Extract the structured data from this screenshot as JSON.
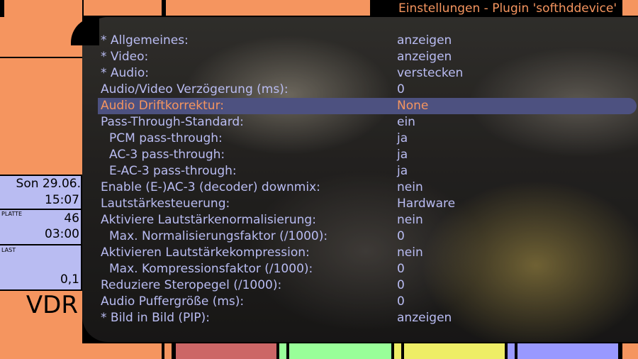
{
  "window": {
    "title": "Einstellungen - Plugin 'softhddevice'"
  },
  "sidebar": {
    "date": "Son 29.06.",
    "time": "15:07",
    "disk_label": "PLATTE",
    "disk_value": "46",
    "disk_time": "03:00",
    "load_label": "LAST",
    "load_value": "0,1",
    "logo": "VDR"
  },
  "menu": {
    "items": [
      {
        "label": "* Allgemeines:",
        "value": "anzeigen"
      },
      {
        "label": "* Video:",
        "value": "anzeigen"
      },
      {
        "label": "* Audio:",
        "value": "verstecken"
      },
      {
        "label": "Audio/Video Verzögerung (ms):",
        "value": "0"
      },
      {
        "label": "Audio Driftkorrektur:",
        "value": "None"
      },
      {
        "label": "Pass-Through-Standard:",
        "value": "ein"
      },
      {
        "label": "PCM pass-through:",
        "value": "ja"
      },
      {
        "label": "AC-3 pass-through:",
        "value": "ja"
      },
      {
        "label": "E-AC-3 pass-through:",
        "value": "ja"
      },
      {
        "label": "Enable (E-)AC-3 (decoder) downmix:",
        "value": "nein"
      },
      {
        "label": "Lautstärkesteuerung:",
        "value": "Hardware"
      },
      {
        "label": "Aktiviere Lautstärkenormalisierung:",
        "value": "nein"
      },
      {
        "label": "Max. Normalisierungsfaktor (/1000):",
        "value": "0"
      },
      {
        "label": "Aktivieren Lautstärkekompression:",
        "value": "nein"
      },
      {
        "label": "Max. Kompressionsfaktor (/1000):",
        "value": "0"
      },
      {
        "label": "Reduziere Steropegel (/1000):",
        "value": "0"
      },
      {
        "label": "Audio Puffergröße (ms):",
        "value": "0"
      },
      {
        "label": "* Bild in Bild (PIP):",
        "value": "anzeigen"
      }
    ]
  },
  "colors": {
    "frame": "#f5955f",
    "accent": "#b9bcf2",
    "selection": "#4d5180",
    "red": "#cc6666",
    "green": "#99ff99",
    "yellow": "#eeee66",
    "blue": "#9999ff"
  }
}
